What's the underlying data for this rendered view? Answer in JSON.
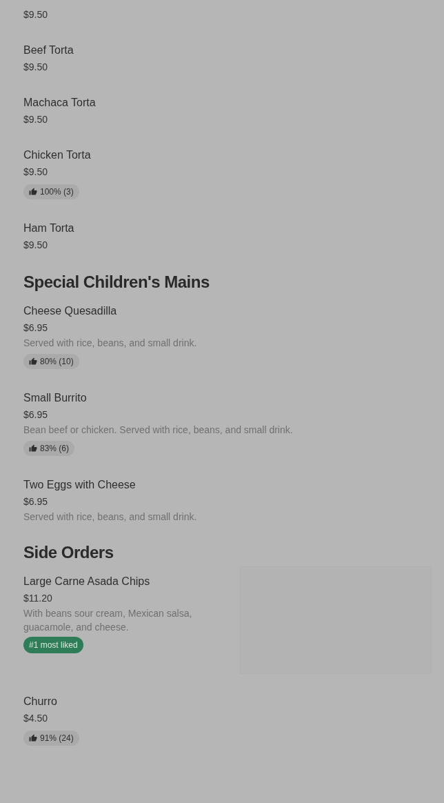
{
  "sections": [
    {
      "items": [
        {
          "price": "$9.50"
        },
        {
          "name": "Beef Torta",
          "price": "$9.50"
        },
        {
          "name": "Machaca Torta",
          "price": "$9.50"
        },
        {
          "name": "Chicken Torta",
          "price": "$9.50",
          "rating": "100% (3)"
        },
        {
          "name": "Ham Torta",
          "price": "$9.50"
        }
      ]
    },
    {
      "heading": "Special Children's Mains",
      "items": [
        {
          "name": "Cheese Quesadilla",
          "price": "$6.95",
          "description": "Served with rice, beans, and small drink.",
          "rating": "80% (10)"
        },
        {
          "name": "Small Burrito",
          "price": "$6.95",
          "description": "Bean beef or chicken. Served with rice, beans, and small drink.",
          "rating": "83% (6)"
        },
        {
          "name": "Two Eggs with Cheese",
          "price": "$6.95",
          "description": "Served with rice, beans, and small drink."
        }
      ]
    },
    {
      "heading": "Side Orders",
      "items": [
        {
          "name": "Large Carne Asada Chips",
          "price": "$11.20",
          "description": "With beans sour cream, Mexican salsa, guacamole, and cheese.",
          "badge": "#1 most liked",
          "has_image": true
        },
        {
          "name": "Churro",
          "price": "$4.50",
          "rating": "91% (24)"
        }
      ]
    }
  ]
}
